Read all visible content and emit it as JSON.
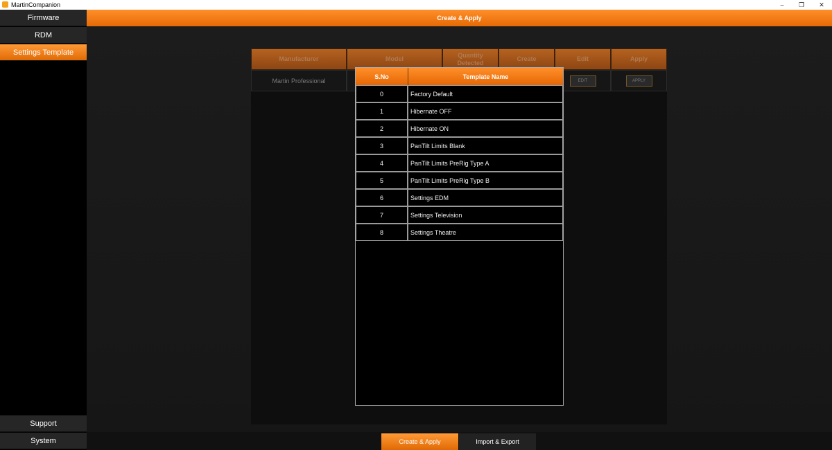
{
  "window": {
    "title": "MartinCompanion",
    "controls": [
      "–",
      "❐",
      "✕"
    ]
  },
  "sidebar": {
    "top_items": [
      {
        "label": "Firmware"
      },
      {
        "label": "RDM"
      },
      {
        "label": "Settings Template"
      }
    ],
    "bottom_items": [
      {
        "label": "Support"
      },
      {
        "label": "System"
      }
    ],
    "active": "Settings Template"
  },
  "header": {
    "title": "Create & Apply"
  },
  "fixture_table": {
    "columns": [
      "Manufacturer",
      "Model",
      "Quantity Detected",
      "Create",
      "Edit",
      "Apply"
    ],
    "rows": [
      {
        "manufacturer": "Martin Professional",
        "edit_label": "EDIT",
        "apply_label": "APPLY"
      }
    ]
  },
  "template_dialog": {
    "columns": [
      "S.No",
      "Template Name"
    ],
    "rows": [
      {
        "sno": "0",
        "name": "Factory Default"
      },
      {
        "sno": "1",
        "name": "Hibernate OFF"
      },
      {
        "sno": "2",
        "name": "Hibernate ON"
      },
      {
        "sno": "3",
        "name": "PanTilt Limits Blank"
      },
      {
        "sno": "4",
        "name": "PanTilt Limits PreRig Type A"
      },
      {
        "sno": "5",
        "name": "PanTilt Limits PreRig Type B"
      },
      {
        "sno": "6",
        "name": "Settings EDM"
      },
      {
        "sno": "7",
        "name": "Settings Television"
      },
      {
        "sno": "8",
        "name": "Settings Theatre"
      }
    ]
  },
  "bottom_tabs": [
    {
      "label": "Create & Apply"
    },
    {
      "label": "Import & Export"
    }
  ],
  "active_bottom_tab": "Create & Apply",
  "colors": {
    "accent": "#f07a12",
    "background": "#000000",
    "panel": "#0e0e0e"
  }
}
